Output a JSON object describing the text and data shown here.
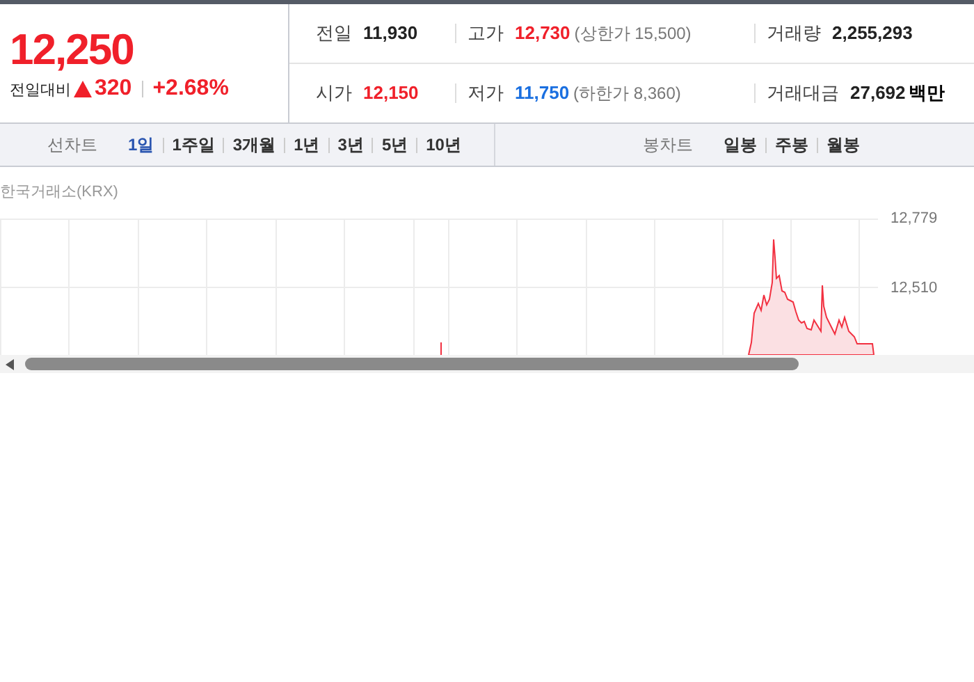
{
  "quote": {
    "price": "12,250",
    "change_label": "전일대비",
    "color": "#f0202a",
    "change": "320",
    "percent": "+2.68%"
  },
  "stats": [
    [
      {
        "label": "전일",
        "value": "11,930",
        "color": "#222222"
      },
      {
        "label": "고가",
        "value": "12,730",
        "color": "#f0202a",
        "note": "(상한가 15,500)"
      },
      {
        "label": "거래량",
        "value": "2,255,293",
        "color": "#222222"
      }
    ],
    [
      {
        "label": "시가",
        "value": "12,150",
        "color": "#f0202a"
      },
      {
        "label": "저가",
        "value": "11,750",
        "color": "#1a6fe0",
        "note": "(하한가 8,360)"
      },
      {
        "label": "거래대금",
        "value": "27,692",
        "color": "#222222",
        "unit": "백만"
      }
    ]
  ],
  "line_chart_tabs": {
    "label": "선차트",
    "items": [
      {
        "label": "1일",
        "selected": true
      },
      {
        "label": "1주일",
        "selected": false
      },
      {
        "label": "3개월",
        "selected": false
      },
      {
        "label": "1년",
        "selected": false
      },
      {
        "label": "3년",
        "selected": false
      },
      {
        "label": "5년",
        "selected": false
      },
      {
        "label": "10년",
        "selected": false
      }
    ]
  },
  "candle_chart_tabs": {
    "label": "봉차트",
    "items": [
      {
        "label": "일봉",
        "selected": false
      },
      {
        "label": "주봉",
        "selected": false
      },
      {
        "label": "월봉",
        "selected": false
      }
    ]
  },
  "chart": {
    "source": "한국거래소(KRX)",
    "y_tick_labels": [
      "12,779",
      "12,510"
    ]
  }
}
